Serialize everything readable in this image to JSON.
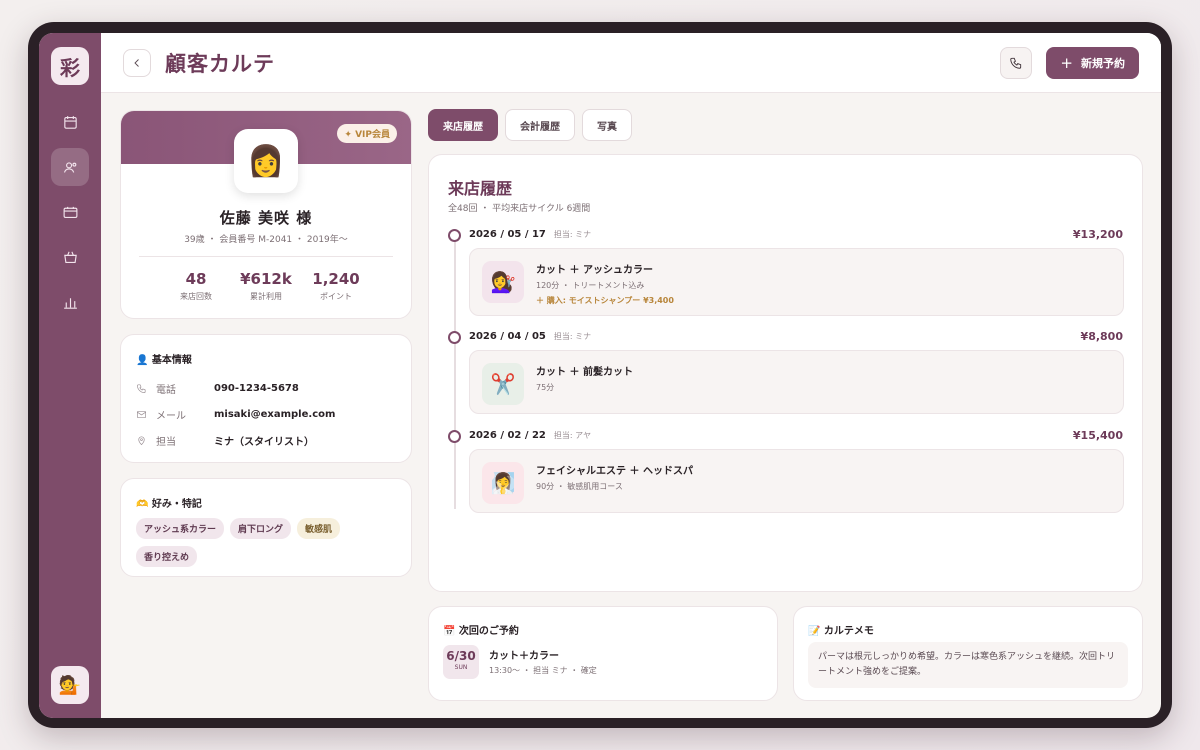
{
  "app": {
    "logo": "彩"
  },
  "sidebar": {
    "items": [
      {
        "icon": "calendar-icon"
      },
      {
        "icon": "customers-icon",
        "active": true
      },
      {
        "icon": "card-icon"
      },
      {
        "icon": "basket-icon"
      },
      {
        "icon": "chart-icon"
      }
    ],
    "user_avatar": "💁"
  },
  "header": {
    "title": "顧客カルテ",
    "new_button": "新規予約",
    "new_button_plus": "+"
  },
  "profile": {
    "badge": "✦ VIP会員",
    "avatar": "👩",
    "name": "佐藤 美咲 様",
    "meta": "39歳 ・ 会員番号 M-2041 ・ 2019年〜",
    "stats": [
      {
        "value": "48",
        "label": "来店回数"
      },
      {
        "value": "¥612k",
        "label": "累計利用"
      },
      {
        "value": "1,240",
        "label": "ポイント"
      }
    ]
  },
  "basic_info": {
    "title": "👤 基本情報",
    "rows": [
      {
        "key": "電話",
        "value": "090-1234-5678"
      },
      {
        "key": "メール",
        "value": "misaki@example.com"
      },
      {
        "key": "担当",
        "value": "ミナ（スタイリスト）"
      }
    ]
  },
  "preferences": {
    "title": "🫶 好み・特記",
    "tags": [
      "アッシュ系カラー",
      "肩下ロング",
      "敏感肌",
      "香り控えめ"
    ]
  },
  "tabs": [
    "来店履歴",
    "会計履歴",
    "写真"
  ],
  "history": {
    "title": "来店履歴",
    "subtitle": "全48回 ・ 平均来店サイクル 6週間",
    "visits": [
      {
        "date": "2026 / 05 / 17",
        "staff": "担当: ミナ",
        "price": "¥13,200",
        "icon": "💇‍♀️",
        "name": "カット ＋ アッシュカラー",
        "detail": "120分 ・ トリートメント込み",
        "extra": "＋ 購入: モイストシャンプー ¥3,400"
      },
      {
        "date": "2026 / 04 / 05",
        "staff": "担当: ミナ",
        "price": "¥8,800",
        "icon": "✂️",
        "name": "カット ＋ 前髪カット",
        "detail": "75分",
        "extra": ""
      },
      {
        "date": "2026 / 02 / 22",
        "staff": "担当: アヤ",
        "price": "¥15,400",
        "icon": "🧖‍♀️",
        "name": "フェイシャルエステ ＋ ヘッドスパ",
        "detail": "90分 ・ 敏感肌用コース",
        "extra": ""
      }
    ]
  },
  "next_booking": {
    "title": "📅 次回のご予約",
    "date": "6/30",
    "weekday": "SUN",
    "name": "カット＋カラー",
    "detail": "13:30〜 ・ 担当 ミナ ・ 確定"
  },
  "memo": {
    "title": "📝 カルテメモ",
    "text": "パーマは根元しっかりめ希望。カラーは寒色系アッシュを継続。次回トリートメント強めをご提案。"
  }
}
